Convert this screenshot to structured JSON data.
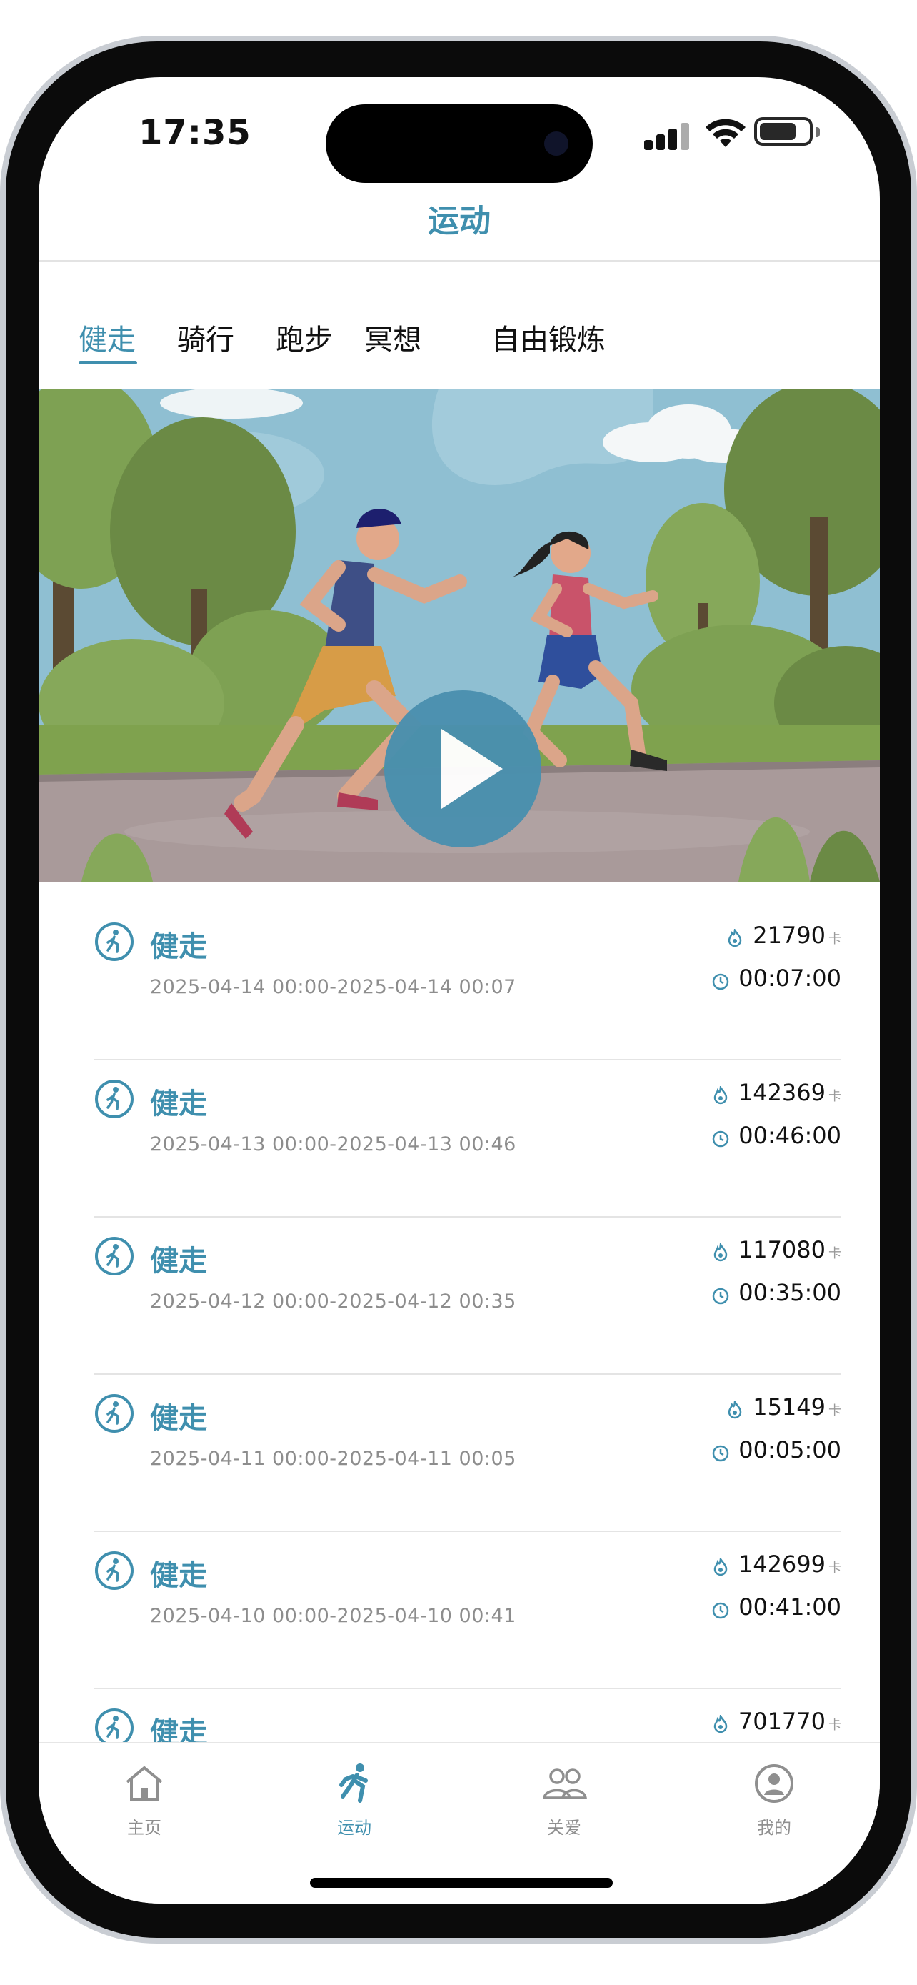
{
  "status_bar": {
    "time": "17:35"
  },
  "nav": {
    "title": "运动"
  },
  "tabs": [
    {
      "label": "健走",
      "active": true
    },
    {
      "label": "骑行",
      "active": false
    },
    {
      "label": "跑步",
      "active": false
    },
    {
      "label": "冥想",
      "active": false
    },
    {
      "label": "自由锻炼",
      "active": false
    }
  ],
  "records": [
    {
      "title": "健走",
      "range": "2025-04-14 00:00-2025-04-14 00:07",
      "kcal": "21790",
      "unit": "卡",
      "duration": "00:07:00"
    },
    {
      "title": "健走",
      "range": "2025-04-13 00:00-2025-04-13 00:46",
      "kcal": "142369",
      "unit": "卡",
      "duration": "00:46:00"
    },
    {
      "title": "健走",
      "range": "2025-04-12 00:00-2025-04-12 00:35",
      "kcal": "117080",
      "unit": "卡",
      "duration": "00:35:00"
    },
    {
      "title": "健走",
      "range": "2025-04-11 00:00-2025-04-11 00:05",
      "kcal": "15149",
      "unit": "卡",
      "duration": "00:05:00"
    },
    {
      "title": "健走",
      "range": "2025-04-10 00:00-2025-04-10 00:41",
      "kcal": "142699",
      "unit": "卡",
      "duration": "00:41:00"
    },
    {
      "title": "健走",
      "range": "",
      "kcal": "701770",
      "unit": "卡",
      "duration": ""
    }
  ],
  "tabbar": [
    {
      "label": "主页",
      "icon": "home-icon",
      "active": false
    },
    {
      "label": "运动",
      "icon": "runner-icon",
      "active": true
    },
    {
      "label": "关爱",
      "icon": "people-icon",
      "active": false
    },
    {
      "label": "我的",
      "icon": "profile-icon",
      "active": false
    }
  ],
  "colors": {
    "accent": "#3f8fae",
    "text": "#111111",
    "muted": "#8d8d8d"
  }
}
